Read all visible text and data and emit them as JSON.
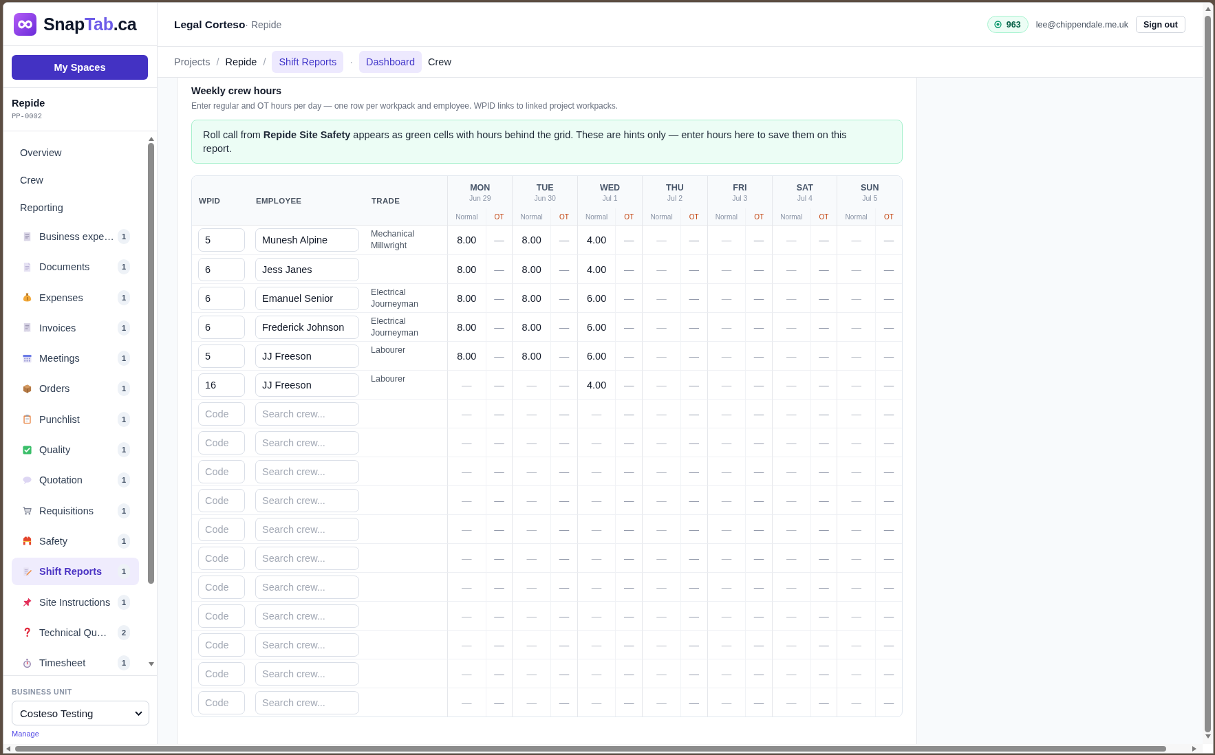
{
  "sidebar": {
    "brand": [
      {
        "text": "Snap",
        "accent": false
      },
      {
        "text": "Tab",
        "accent": true
      },
      {
        "text": ".ca",
        "accent": false
      }
    ],
    "spaces_button": "My Spaces",
    "project": {
      "name": "Repide",
      "code": "PP-0002"
    },
    "nav": [
      {
        "label": "Overview",
        "selected": false
      },
      {
        "label": "Crew",
        "selected": false
      },
      {
        "label": "Reporting",
        "selected": false
      }
    ],
    "reports": [
      {
        "label": "Business expe…",
        "count": "1",
        "selected": false
      },
      {
        "label": "Documents",
        "count": "1",
        "selected": false
      },
      {
        "label": "Expenses",
        "count": "1",
        "selected": false
      },
      {
        "label": "Invoices",
        "count": "1",
        "selected": false
      },
      {
        "label": "Meetings",
        "count": "1",
        "selected": false
      },
      {
        "label": "Orders",
        "count": "1",
        "selected": false
      },
      {
        "label": "Punchlist",
        "count": "1",
        "selected": false
      },
      {
        "label": "Quality",
        "count": "1",
        "selected": false
      },
      {
        "label": "Quotation",
        "count": "1",
        "selected": false
      },
      {
        "label": "Requisitions",
        "count": "1",
        "selected": false
      },
      {
        "label": "Safety",
        "count": "1",
        "selected": false
      },
      {
        "label": "Shift Reports",
        "count": "1",
        "selected": true
      },
      {
        "label": "Site Instructions",
        "count": "1",
        "selected": false
      },
      {
        "label": "Technical Qu…",
        "count": "2",
        "selected": false
      },
      {
        "label": "Timesheet",
        "count": "1",
        "selected": false
      }
    ],
    "business_unit": {
      "label": "BUSINESS UNIT",
      "value": "Costeso Testing",
      "link": "Manage"
    }
  },
  "header": {
    "title": "Legal Corteso",
    "subtitle": "· Repide",
    "points": "963",
    "email": "lee@chippendale.me.uk",
    "sign_out": "Sign out"
  },
  "breadcrumb": {
    "items": [
      {
        "label": "Projects",
        "kind": "link",
        "separator": "/"
      },
      {
        "label": "Repide",
        "kind": "page",
        "separator": "/"
      },
      {
        "label": "Shift Reports",
        "kind": "current",
        "separator": "·"
      }
    ],
    "tabs": [
      {
        "label": "Dashboard",
        "selected": true
      },
      {
        "label": "Crew",
        "selected": false
      }
    ]
  },
  "section": {
    "title": "Weekly crew hours",
    "description": "Enter regular and OT hours per day — one row per workpack and employee. WPID links to linked project workpacks.",
    "notice": "Roll call from **Repide Site Safety** appears as green cells with hours behind the grid. These are hints only — enter hours here to save them on this report."
  },
  "table": {
    "columns": [
      "WPID",
      "EMPLOYEE",
      "TRADE"
    ],
    "days": [
      {
        "day": "MON",
        "date": "Jun 29",
        "normal": "Normal",
        "ot": "OT"
      },
      {
        "day": "TUE",
        "date": "Jun 30",
        "normal": "Normal",
        "ot": "OT"
      },
      {
        "day": "WED",
        "date": "Jul 1",
        "normal": "Normal",
        "ot": "OT"
      },
      {
        "day": "THU",
        "date": "Jul 2",
        "normal": "Normal",
        "ot": "OT"
      },
      {
        "day": "FRI",
        "date": "Jul 3",
        "normal": "Normal",
        "ot": "OT"
      },
      {
        "day": "SAT",
        "date": "Jul 4",
        "normal": "Normal",
        "ot": "OT"
      },
      {
        "day": "SUN",
        "date": "Jul 5",
        "normal": "Normal",
        "ot": "OT"
      }
    ],
    "rows": [
      {
        "wpid": {
          "value": "5"
        },
        "employee": {
          "value": "Munesh Alpine"
        },
        "trade": "Mechanical Millwright",
        "hours": [
          {
            "value": "8.00",
            "entered": true
          },
          {
            "value": "—",
            "entered": false
          },
          {
            "value": "8.00",
            "entered": true
          },
          {
            "value": "—",
            "entered": false
          },
          {
            "value": "4.00",
            "entered": true
          },
          {
            "value": "—",
            "entered": false
          },
          {
            "value": "—",
            "entered": false
          },
          {
            "value": "—",
            "entered": false
          },
          {
            "value": "—",
            "entered": false
          },
          {
            "value": "—",
            "entered": false
          },
          {
            "value": "—",
            "entered": false
          },
          {
            "value": "—",
            "entered": false
          },
          {
            "value": "—",
            "entered": false
          },
          {
            "value": "—",
            "entered": false
          }
        ]
      },
      {
        "wpid": {
          "value": "6"
        },
        "employee": {
          "value": "Jess Janes"
        },
        "hours": [
          {
            "value": "8.00",
            "entered": true
          },
          {
            "value": "—",
            "entered": false
          },
          {
            "value": "8.00",
            "entered": true
          },
          {
            "value": "—",
            "entered": false
          },
          {
            "value": "4.00",
            "entered": true
          },
          {
            "value": "—",
            "entered": false
          },
          {
            "value": "—",
            "entered": false
          },
          {
            "value": "—",
            "entered": false
          },
          {
            "value": "—",
            "entered": false
          },
          {
            "value": "—",
            "entered": false
          },
          {
            "value": "—",
            "entered": false
          },
          {
            "value": "—",
            "entered": false
          },
          {
            "value": "—",
            "entered": false
          },
          {
            "value": "—",
            "entered": false
          }
        ]
      },
      {
        "wpid": {
          "value": "6"
        },
        "employee": {
          "value": "Emanuel Senior"
        },
        "trade": "Electrical Journeyman",
        "hours": [
          {
            "value": "8.00",
            "entered": true
          },
          {
            "value": "—",
            "entered": false
          },
          {
            "value": "8.00",
            "entered": true
          },
          {
            "value": "—",
            "entered": false
          },
          {
            "value": "6.00",
            "entered": true
          },
          {
            "value": "—",
            "entered": false
          },
          {
            "value": "—",
            "entered": false
          },
          {
            "value": "—",
            "entered": false
          },
          {
            "value": "—",
            "entered": false
          },
          {
            "value": "—",
            "entered": false
          },
          {
            "value": "—",
            "entered": false
          },
          {
            "value": "—",
            "entered": false
          },
          {
            "value": "—",
            "entered": false
          },
          {
            "value": "—",
            "entered": false
          }
        ]
      },
      {
        "wpid": {
          "value": "6"
        },
        "employee": {
          "value": "Frederick Johnson"
        },
        "trade": "Electrical Journeyman",
        "hours": [
          {
            "value": "8.00",
            "entered": true
          },
          {
            "value": "—",
            "entered": false
          },
          {
            "value": "8.00",
            "entered": true
          },
          {
            "value": "—",
            "entered": false
          },
          {
            "value": "6.00",
            "entered": true
          },
          {
            "value": "—",
            "entered": false
          },
          {
            "value": "—",
            "entered": false
          },
          {
            "value": "—",
            "entered": false
          },
          {
            "value": "—",
            "entered": false
          },
          {
            "value": "—",
            "entered": false
          },
          {
            "value": "—",
            "entered": false
          },
          {
            "value": "—",
            "entered": false
          },
          {
            "value": "—",
            "entered": false
          },
          {
            "value": "—",
            "entered": false
          }
        ]
      },
      {
        "wpid": {
          "value": "5"
        },
        "employee": {
          "value": "JJ Freeson"
        },
        "trade": "Labourer",
        "hours": [
          {
            "value": "8.00",
            "entered": true
          },
          {
            "value": "—",
            "entered": false
          },
          {
            "value": "8.00",
            "entered": true
          },
          {
            "value": "—",
            "entered": false
          },
          {
            "value": "6.00",
            "entered": true
          },
          {
            "value": "—",
            "entered": false
          },
          {
            "value": "—",
            "entered": false
          },
          {
            "value": "—",
            "entered": false
          },
          {
            "value": "—",
            "entered": false
          },
          {
            "value": "—",
            "entered": false
          },
          {
            "value": "—",
            "entered": false
          },
          {
            "value": "—",
            "entered": false
          },
          {
            "value": "—",
            "entered": false
          },
          {
            "value": "—",
            "entered": false
          }
        ]
      },
      {
        "wpid": {
          "value": "16"
        },
        "employee": {
          "value": "JJ Freeson"
        },
        "trade": "Labourer",
        "hours": [
          {
            "value": "—",
            "entered": false
          },
          {
            "value": "—",
            "entered": false
          },
          {
            "value": "—",
            "entered": false
          },
          {
            "value": "—",
            "entered": false
          },
          {
            "value": "4.00",
            "entered": true
          },
          {
            "value": "—",
            "entered": false
          },
          {
            "value": "—",
            "entered": false
          },
          {
            "value": "—",
            "entered": false
          },
          {
            "value": "—",
            "entered": false
          },
          {
            "value": "—",
            "entered": false
          },
          {
            "value": "—",
            "entered": false
          },
          {
            "value": "—",
            "entered": false
          },
          {
            "value": "—",
            "entered": false
          },
          {
            "value": "—",
            "entered": false
          }
        ]
      },
      {
        "wpid": {
          "placeholder": "Code"
        },
        "employee": {
          "placeholder": "Search crew..."
        },
        "hours": [
          {
            "value": "—",
            "entered": false
          },
          {
            "value": "—",
            "entered": false
          },
          {
            "value": "—",
            "entered": false
          },
          {
            "value": "—",
            "entered": false
          },
          {
            "value": "—",
            "entered": false
          },
          {
            "value": "—",
            "entered": false
          },
          {
            "value": "—",
            "entered": false
          },
          {
            "value": "—",
            "entered": false
          },
          {
            "value": "—",
            "entered": false
          },
          {
            "value": "—",
            "entered": false
          },
          {
            "value": "—",
            "entered": false
          },
          {
            "value": "—",
            "entered": false
          },
          {
            "value": "—",
            "entered": false
          },
          {
            "value": "—",
            "entered": false
          }
        ]
      },
      {
        "wpid": {
          "placeholder": "Code"
        },
        "employee": {
          "placeholder": "Search crew..."
        },
        "hours": [
          {
            "value": "—",
            "entered": false
          },
          {
            "value": "—",
            "entered": false
          },
          {
            "value": "—",
            "entered": false
          },
          {
            "value": "—",
            "entered": false
          },
          {
            "value": "—",
            "entered": false
          },
          {
            "value": "—",
            "entered": false
          },
          {
            "value": "—",
            "entered": false
          },
          {
            "value": "—",
            "entered": false
          },
          {
            "value": "—",
            "entered": false
          },
          {
            "value": "—",
            "entered": false
          },
          {
            "value": "—",
            "entered": false
          },
          {
            "value": "—",
            "entered": false
          },
          {
            "value": "—",
            "entered": false
          },
          {
            "value": "—",
            "entered": false
          }
        ]
      },
      {
        "wpid": {
          "placeholder": "Code"
        },
        "employee": {
          "placeholder": "Search crew..."
        },
        "hours": [
          {
            "value": "—",
            "entered": false
          },
          {
            "value": "—",
            "entered": false
          },
          {
            "value": "—",
            "entered": false
          },
          {
            "value": "—",
            "entered": false
          },
          {
            "value": "—",
            "entered": false
          },
          {
            "value": "—",
            "entered": false
          },
          {
            "value": "—",
            "entered": false
          },
          {
            "value": "—",
            "entered": false
          },
          {
            "value": "—",
            "entered": false
          },
          {
            "value": "—",
            "entered": false
          },
          {
            "value": "—",
            "entered": false
          },
          {
            "value": "—",
            "entered": false
          },
          {
            "value": "—",
            "entered": false
          },
          {
            "value": "—",
            "entered": false
          }
        ]
      },
      {
        "wpid": {
          "placeholder": "Code"
        },
        "employee": {
          "placeholder": "Search crew..."
        },
        "hours": [
          {
            "value": "—",
            "entered": false
          },
          {
            "value": "—",
            "entered": false
          },
          {
            "value": "—",
            "entered": false
          },
          {
            "value": "—",
            "entered": false
          },
          {
            "value": "—",
            "entered": false
          },
          {
            "value": "—",
            "entered": false
          },
          {
            "value": "—",
            "entered": false
          },
          {
            "value": "—",
            "entered": false
          },
          {
            "value": "—",
            "entered": false
          },
          {
            "value": "—",
            "entered": false
          },
          {
            "value": "—",
            "entered": false
          },
          {
            "value": "—",
            "entered": false
          },
          {
            "value": "—",
            "entered": false
          },
          {
            "value": "—",
            "entered": false
          }
        ]
      },
      {
        "wpid": {
          "placeholder": "Code"
        },
        "employee": {
          "placeholder": "Search crew..."
        },
        "hours": [
          {
            "value": "—",
            "entered": false
          },
          {
            "value": "—",
            "entered": false
          },
          {
            "value": "—",
            "entered": false
          },
          {
            "value": "—",
            "entered": false
          },
          {
            "value": "—",
            "entered": false
          },
          {
            "value": "—",
            "entered": false
          },
          {
            "value": "—",
            "entered": false
          },
          {
            "value": "—",
            "entered": false
          },
          {
            "value": "—",
            "entered": false
          },
          {
            "value": "—",
            "entered": false
          },
          {
            "value": "—",
            "entered": false
          },
          {
            "value": "—",
            "entered": false
          },
          {
            "value": "—",
            "entered": false
          },
          {
            "value": "—",
            "entered": false
          }
        ]
      },
      {
        "wpid": {
          "placeholder": "Code"
        },
        "employee": {
          "placeholder": "Search crew..."
        },
        "hours": [
          {
            "value": "—",
            "entered": false
          },
          {
            "value": "—",
            "entered": false
          },
          {
            "value": "—",
            "entered": false
          },
          {
            "value": "—",
            "entered": false
          },
          {
            "value": "—",
            "entered": false
          },
          {
            "value": "—",
            "entered": false
          },
          {
            "value": "—",
            "entered": false
          },
          {
            "value": "—",
            "entered": false
          },
          {
            "value": "—",
            "entered": false
          },
          {
            "value": "—",
            "entered": false
          },
          {
            "value": "—",
            "entered": false
          },
          {
            "value": "—",
            "entered": false
          },
          {
            "value": "—",
            "entered": false
          },
          {
            "value": "—",
            "entered": false
          }
        ]
      },
      {
        "wpid": {
          "placeholder": "Code"
        },
        "employee": {
          "placeholder": "Search crew..."
        },
        "hours": [
          {
            "value": "—",
            "entered": false
          },
          {
            "value": "—",
            "entered": false
          },
          {
            "value": "—",
            "entered": false
          },
          {
            "value": "—",
            "entered": false
          },
          {
            "value": "—",
            "entered": false
          },
          {
            "value": "—",
            "entered": false
          },
          {
            "value": "—",
            "entered": false
          },
          {
            "value": "—",
            "entered": false
          },
          {
            "value": "—",
            "entered": false
          },
          {
            "value": "—",
            "entered": false
          },
          {
            "value": "—",
            "entered": false
          },
          {
            "value": "—",
            "entered": false
          },
          {
            "value": "—",
            "entered": false
          },
          {
            "value": "—",
            "entered": false
          }
        ]
      },
      {
        "wpid": {
          "placeholder": "Code"
        },
        "employee": {
          "placeholder": "Search crew..."
        },
        "hours": [
          {
            "value": "—",
            "entered": false
          },
          {
            "value": "—",
            "entered": false
          },
          {
            "value": "—",
            "entered": false
          },
          {
            "value": "—",
            "entered": false
          },
          {
            "value": "—",
            "entered": false
          },
          {
            "value": "—",
            "entered": false
          },
          {
            "value": "—",
            "entered": false
          },
          {
            "value": "—",
            "entered": false
          },
          {
            "value": "—",
            "entered": false
          },
          {
            "value": "—",
            "entered": false
          },
          {
            "value": "—",
            "entered": false
          },
          {
            "value": "—",
            "entered": false
          },
          {
            "value": "—",
            "entered": false
          },
          {
            "value": "—",
            "entered": false
          }
        ]
      },
      {
        "wpid": {
          "placeholder": "Code"
        },
        "employee": {
          "placeholder": "Search crew..."
        },
        "hours": [
          {
            "value": "—",
            "entered": false
          },
          {
            "value": "—",
            "entered": false
          },
          {
            "value": "—",
            "entered": false
          },
          {
            "value": "—",
            "entered": false
          },
          {
            "value": "—",
            "entered": false
          },
          {
            "value": "—",
            "entered": false
          },
          {
            "value": "—",
            "entered": false
          },
          {
            "value": "—",
            "entered": false
          },
          {
            "value": "—",
            "entered": false
          },
          {
            "value": "—",
            "entered": false
          },
          {
            "value": "—",
            "entered": false
          },
          {
            "value": "—",
            "entered": false
          },
          {
            "value": "—",
            "entered": false
          },
          {
            "value": "—",
            "entered": false
          }
        ]
      },
      {
        "wpid": {
          "placeholder": "Code"
        },
        "employee": {
          "placeholder": "Search crew..."
        },
        "hours": [
          {
            "value": "—",
            "entered": false
          },
          {
            "value": "—",
            "entered": false
          },
          {
            "value": "—",
            "entered": false
          },
          {
            "value": "—",
            "entered": false
          },
          {
            "value": "—",
            "entered": false
          },
          {
            "value": "—",
            "entered": false
          },
          {
            "value": "—",
            "entered": false
          },
          {
            "value": "—",
            "entered": false
          },
          {
            "value": "—",
            "entered": false
          },
          {
            "value": "—",
            "entered": false
          },
          {
            "value": "—",
            "entered": false
          },
          {
            "value": "—",
            "entered": false
          },
          {
            "value": "—",
            "entered": false
          },
          {
            "value": "—",
            "entered": false
          }
        ]
      },
      {
        "wpid": {
          "placeholder": "Code"
        },
        "employee": {
          "placeholder": "Search crew..."
        },
        "hours": [
          {
            "value": "—",
            "entered": false
          },
          {
            "value": "—",
            "entered": false
          },
          {
            "value": "—",
            "entered": false
          },
          {
            "value": "—",
            "entered": false
          },
          {
            "value": "—",
            "entered": false
          },
          {
            "value": "—",
            "entered": false
          },
          {
            "value": "—",
            "entered": false
          },
          {
            "value": "—",
            "entered": false
          },
          {
            "value": "—",
            "entered": false
          },
          {
            "value": "—",
            "entered": false
          },
          {
            "value": "—",
            "entered": false
          },
          {
            "value": "—",
            "entered": false
          },
          {
            "value": "—",
            "entered": false
          },
          {
            "value": "—",
            "entered": false
          }
        ]
      }
    ]
  }
}
